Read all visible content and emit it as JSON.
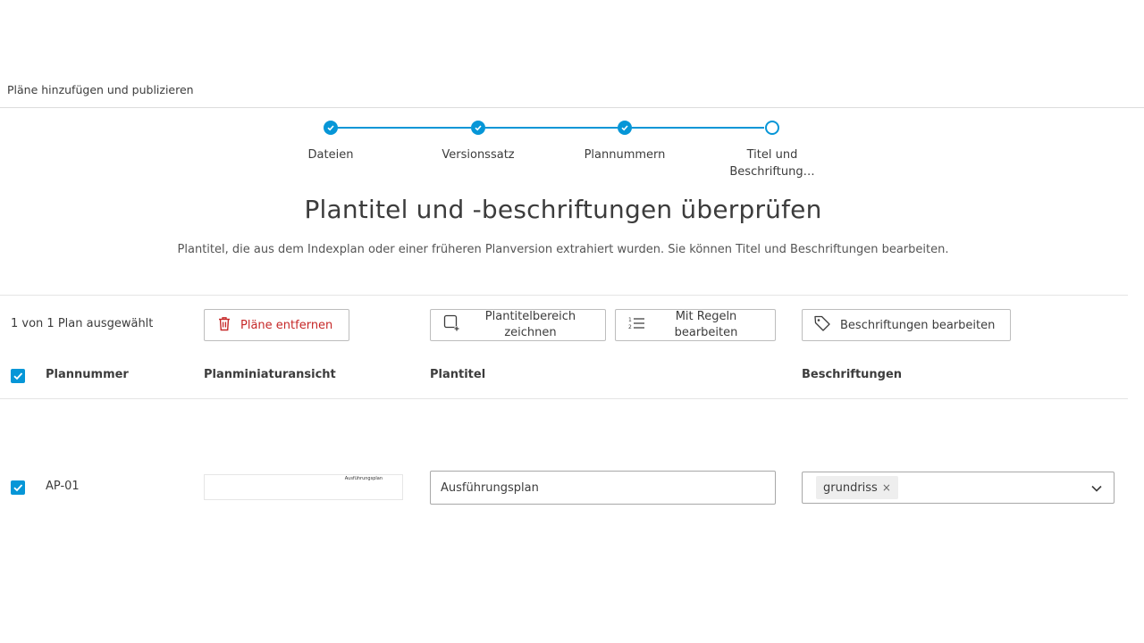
{
  "header": {
    "title": "Pläne hinzufügen und publizieren"
  },
  "stepper": {
    "steps": [
      {
        "label": "Dateien",
        "state": "done"
      },
      {
        "label": "Versionssatz",
        "state": "done"
      },
      {
        "label": "Plannummern",
        "state": "done"
      },
      {
        "label": "Titel und Beschriftung…",
        "state": "current"
      }
    ]
  },
  "main": {
    "title": "Plantitel und -beschriftungen überprüfen",
    "subtitle": "Plantitel, die aus dem Indexplan oder einer früheren Planversion extrahiert wurden. Sie können Titel und Beschriftungen bearbeiten."
  },
  "toolbar": {
    "selection_count": "1 von 1 Plan ausgewählt",
    "remove_label": "Pläne entfernen",
    "draw_label": "Plantitelbereich zeichnen",
    "rules_label": "Mit Regeln bearbeiten",
    "tags_label": "Beschriftungen bearbeiten"
  },
  "table": {
    "columns": {
      "number": "Plannummer",
      "thumbnail": "Planminiaturansicht",
      "title": "Plantitel",
      "tags": "Beschriftungen"
    },
    "rows": [
      {
        "number": "AP-01",
        "thumbnail_text": "Ausführungsplan",
        "title": "Ausführungsplan",
        "tags": [
          "grundriss"
        ]
      }
    ]
  },
  "colors": {
    "accent": "#0696d7",
    "danger": "#c62828"
  }
}
